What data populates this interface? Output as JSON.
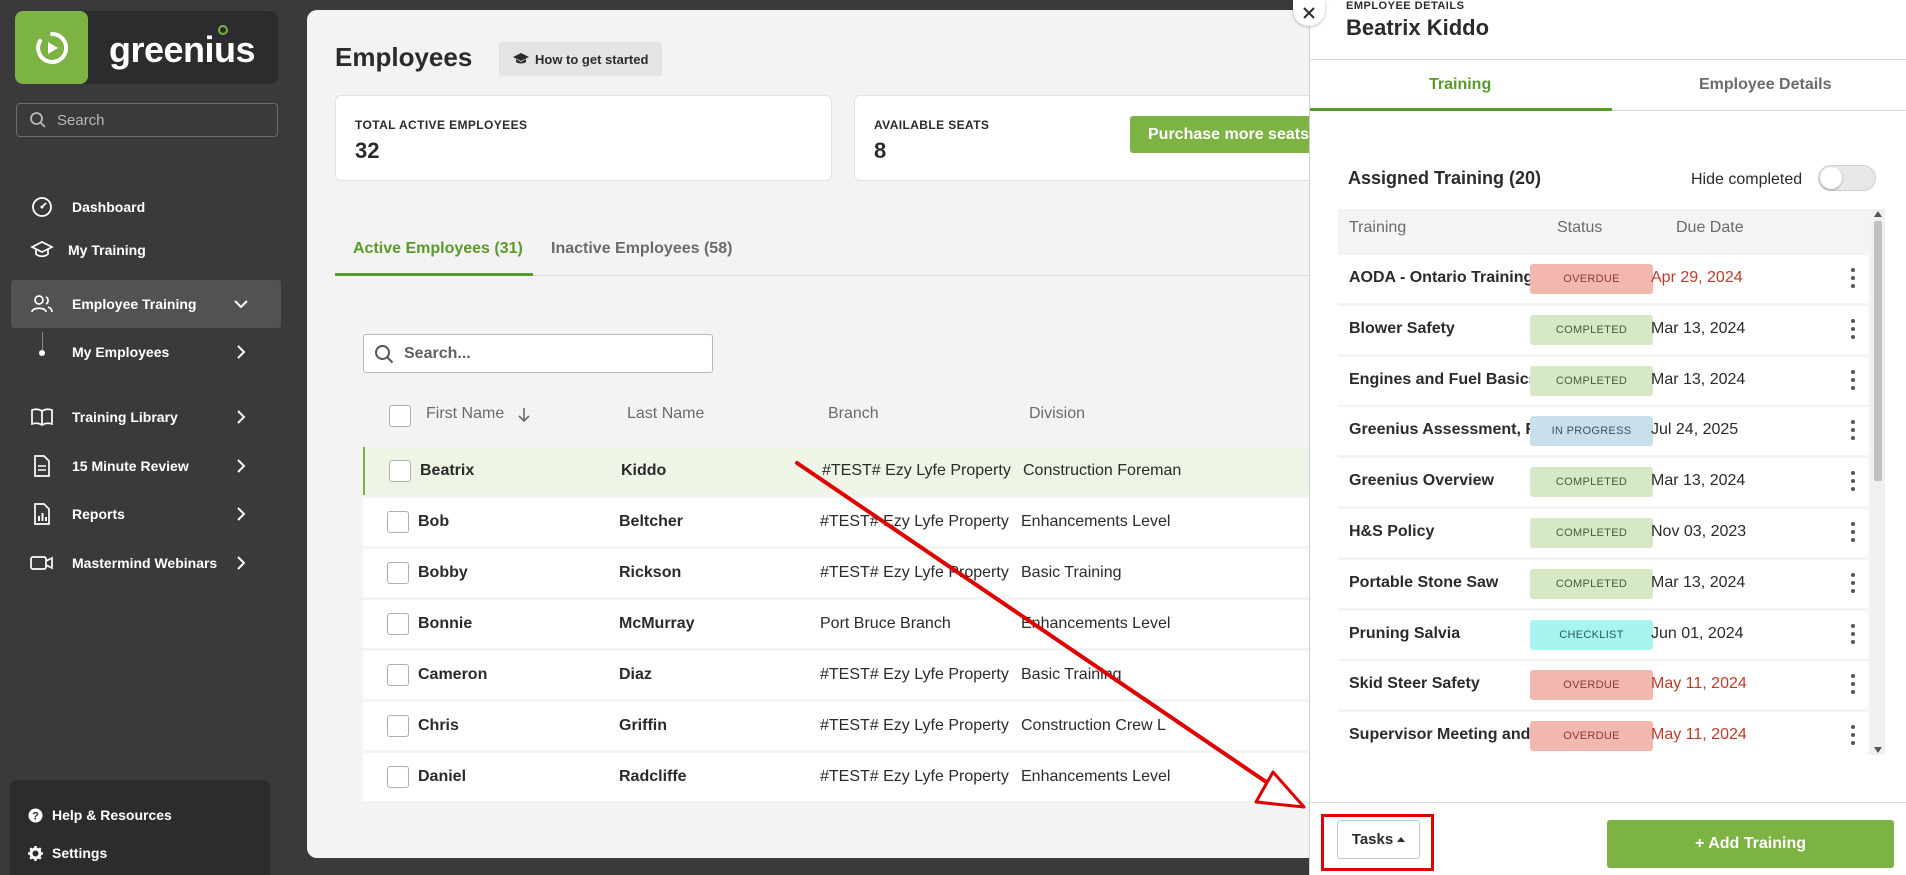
{
  "brand": {
    "name": "greenius",
    "accent": "#7cb342"
  },
  "sidebar": {
    "search_placeholder": "Search",
    "items": [
      {
        "label": "Dashboard",
        "icon": "gauge-icon"
      },
      {
        "label": "My Training",
        "icon": "graduation-cap-icon"
      },
      {
        "label": "Employee Training",
        "icon": "users-icon"
      },
      {
        "label": "My Employees"
      },
      {
        "label": "Training Library",
        "icon": "book-icon"
      },
      {
        "label": "15 Minute Review",
        "icon": "document-icon"
      },
      {
        "label": "Reports",
        "icon": "report-icon"
      },
      {
        "label": "Mastermind Webinars",
        "icon": "video-icon"
      }
    ],
    "bottom": [
      {
        "label": "Help & Resources",
        "icon": "help-icon"
      },
      {
        "label": "Settings",
        "icon": "gear-icon"
      }
    ]
  },
  "main": {
    "title": "Employees",
    "howto_label": "How to get started",
    "stats": {
      "total_label": "TOTAL ACTIVE EMPLOYEES",
      "total_value": "32",
      "seats_label": "AVAILABLE SEATS",
      "seats_value": "8",
      "purchase_label": "Purchase more seats"
    },
    "tabs": [
      "Active Employees (31)",
      "Inactive Employees (58)"
    ],
    "search_placeholder": "Search...",
    "columns": [
      "First Name",
      "Last Name",
      "Branch",
      "Division"
    ],
    "rows": [
      {
        "first": "Beatrix",
        "last": "Kiddo",
        "branch": "#TEST# Ezy Lyfe Property",
        "division": "Construction Foreman"
      },
      {
        "first": "Bob",
        "last": "Beltcher",
        "branch": "#TEST# Ezy Lyfe Property",
        "division": "Enhancements Level"
      },
      {
        "first": "Bobby",
        "last": "Rickson",
        "branch": "#TEST# Ezy Lyfe Property",
        "division": "Basic Training"
      },
      {
        "first": "Bonnie",
        "last": "McMurray",
        "branch": "Port Bruce Branch",
        "division": "Enhancements Level"
      },
      {
        "first": "Cameron",
        "last": "Diaz",
        "branch": "#TEST# Ezy Lyfe Property",
        "division": "Basic Training"
      },
      {
        "first": "Chris",
        "last": "Griffin",
        "branch": "#TEST# Ezy Lyfe Property",
        "division": "Construction Crew L"
      },
      {
        "first": "Daniel",
        "last": "Radcliffe",
        "branch": "#TEST# Ezy Lyfe Property",
        "division": "Enhancements Level"
      }
    ]
  },
  "panel": {
    "eyebrow": "EMPLOYEE DETAILS",
    "name": "Beatrix Kiddo",
    "tabs": [
      "Training",
      "Employee Details"
    ],
    "section_title": "Assigned Training (20)",
    "hide_completed_label": "Hide completed",
    "columns": [
      "Training",
      "Status",
      "Due Date"
    ],
    "rows": [
      {
        "name": "AODA - Ontario Training",
        "status": "OVERDUE",
        "due": "Apr 29, 2024"
      },
      {
        "name": "Blower Safety",
        "status": "COMPLETED",
        "due": "Mar 13, 2024"
      },
      {
        "name": "Engines and Fuel Basics",
        "status": "COMPLETED",
        "due": "Mar 13, 2024"
      },
      {
        "name": "Greenius Assessment, R...",
        "status": "IN PROGRESS",
        "due": "Jul 24, 2025"
      },
      {
        "name": "Greenius Overview",
        "status": "COMPLETED",
        "due": "Mar 13, 2024"
      },
      {
        "name": "H&S Policy",
        "status": "COMPLETED",
        "due": "Nov 03, 2023"
      },
      {
        "name": "Portable Stone Saw",
        "status": "COMPLETED",
        "due": "Mar 13, 2024"
      },
      {
        "name": "Pruning Salvia",
        "status": "CHECKLIST",
        "due": "Jun 01, 2024"
      },
      {
        "name": "Skid Steer Safety",
        "status": "OVERDUE",
        "due": "May 11, 2024"
      },
      {
        "name": "Supervisor Meeting and ...",
        "status": "OVERDUE",
        "due": "May 11, 2024"
      }
    ],
    "status_colors": {
      "OVERDUE": {
        "bg": "#f2b8b0",
        "fg": "#8a3a30",
        "date": "#c0392b"
      },
      "COMPLETED": {
        "bg": "#d6e8c4",
        "fg": "#4a5a3a",
        "date": "#2b2b2b"
      },
      "IN PROGRESS": {
        "bg": "#c8e0ec",
        "fg": "#3a5060",
        "date": "#2b2b2b"
      },
      "CHECKLIST": {
        "bg": "#a8f4ee",
        "fg": "#2a5a56",
        "date": "#2b2b2b"
      }
    },
    "tasks_label": "Tasks",
    "add_label": "+ Add Training"
  }
}
